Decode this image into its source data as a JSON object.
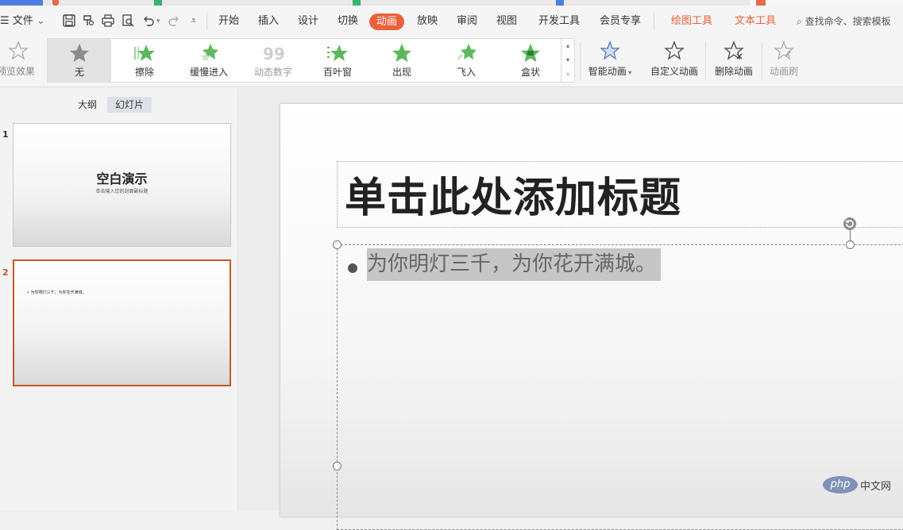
{
  "menu": {
    "file_label": "文件",
    "tabs": [
      "开始",
      "插入",
      "设计",
      "切换",
      "动画",
      "放映",
      "审阅",
      "视图",
      "开发工具",
      "会员专享"
    ],
    "active_tab": "动画",
    "context_tabs": [
      "绘图工具",
      "文本工具"
    ],
    "search_label": "查找命令、搜索模板"
  },
  "ribbon": {
    "preview_label": "预览效果",
    "gallery": [
      "无",
      "擦除",
      "缓慢进入",
      "动态数字",
      "百叶窗",
      "出现",
      "飞入",
      "盒状"
    ],
    "smart_animation": "智能动画",
    "custom_animation": "自定义动画",
    "delete_animation": "删除动画",
    "animation_brush": "动画刷"
  },
  "panel": {
    "tabs": [
      "大纲",
      "幻灯片"
    ],
    "active_tab": "幻灯片",
    "slides": [
      {
        "number": "1",
        "title": "空白演示",
        "subtitle": "单击输入您的封面副标题"
      },
      {
        "number": "2",
        "bullet": "为你明灯三千，为你花开满城。"
      }
    ]
  },
  "slide": {
    "title_placeholder": "单击此处添加标题",
    "bullet_text": "为你明灯三千，为你花开满城。"
  },
  "watermark": {
    "logo": "php",
    "text": "中文网"
  },
  "colors": {
    "accent": "#e8613b",
    "selected_thumb": "#c55a24",
    "star_green": "#5cb85c"
  }
}
